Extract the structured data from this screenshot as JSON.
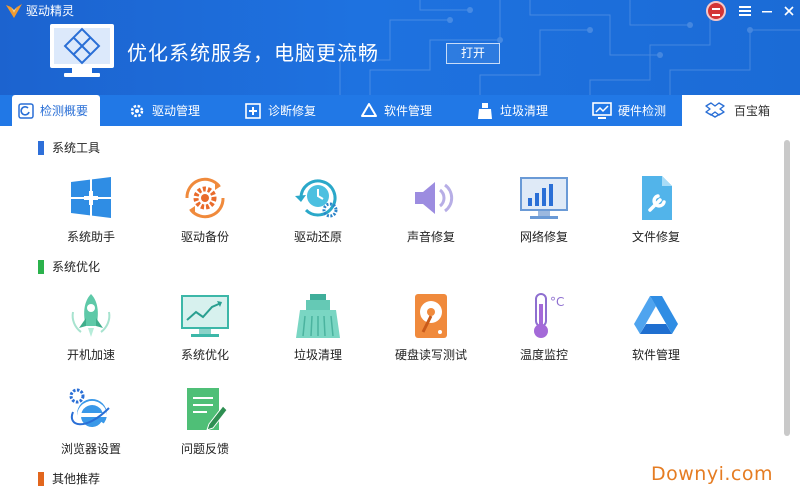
{
  "window": {
    "title": "驱动精灵"
  },
  "banner": {
    "text": "优化系统服务，电脑更流畅",
    "open_label": "打开"
  },
  "tabs": [
    {
      "label": "检测概要",
      "icon": "scan-icon"
    },
    {
      "label": "驱动管理",
      "icon": "gear-icon"
    },
    {
      "label": "诊断修复",
      "icon": "repair-icon"
    },
    {
      "label": "软件管理",
      "icon": "software-icon"
    },
    {
      "label": "垃圾清理",
      "icon": "broom-icon"
    },
    {
      "label": "硬件检测",
      "icon": "monitor-icon"
    },
    {
      "label": "百宝箱",
      "icon": "box-icon"
    }
  ],
  "sections": [
    {
      "title": "系统工具",
      "color": "#2e6fd9",
      "items": [
        "系统助手",
        "驱动备份",
        "驱动还原",
        "声音修复",
        "网络修复",
        "文件修复"
      ]
    },
    {
      "title": "系统优化",
      "color": "#2bb24c",
      "items": [
        "开机加速",
        "系统优化",
        "垃圾清理",
        "硬盘读写测试",
        "温度监控",
        "软件管理",
        "浏览器设置",
        "问题反馈"
      ]
    },
    {
      "title": "其他推荐",
      "color": "#e2661d",
      "items": []
    }
  ],
  "watermark": "Downyi.com"
}
